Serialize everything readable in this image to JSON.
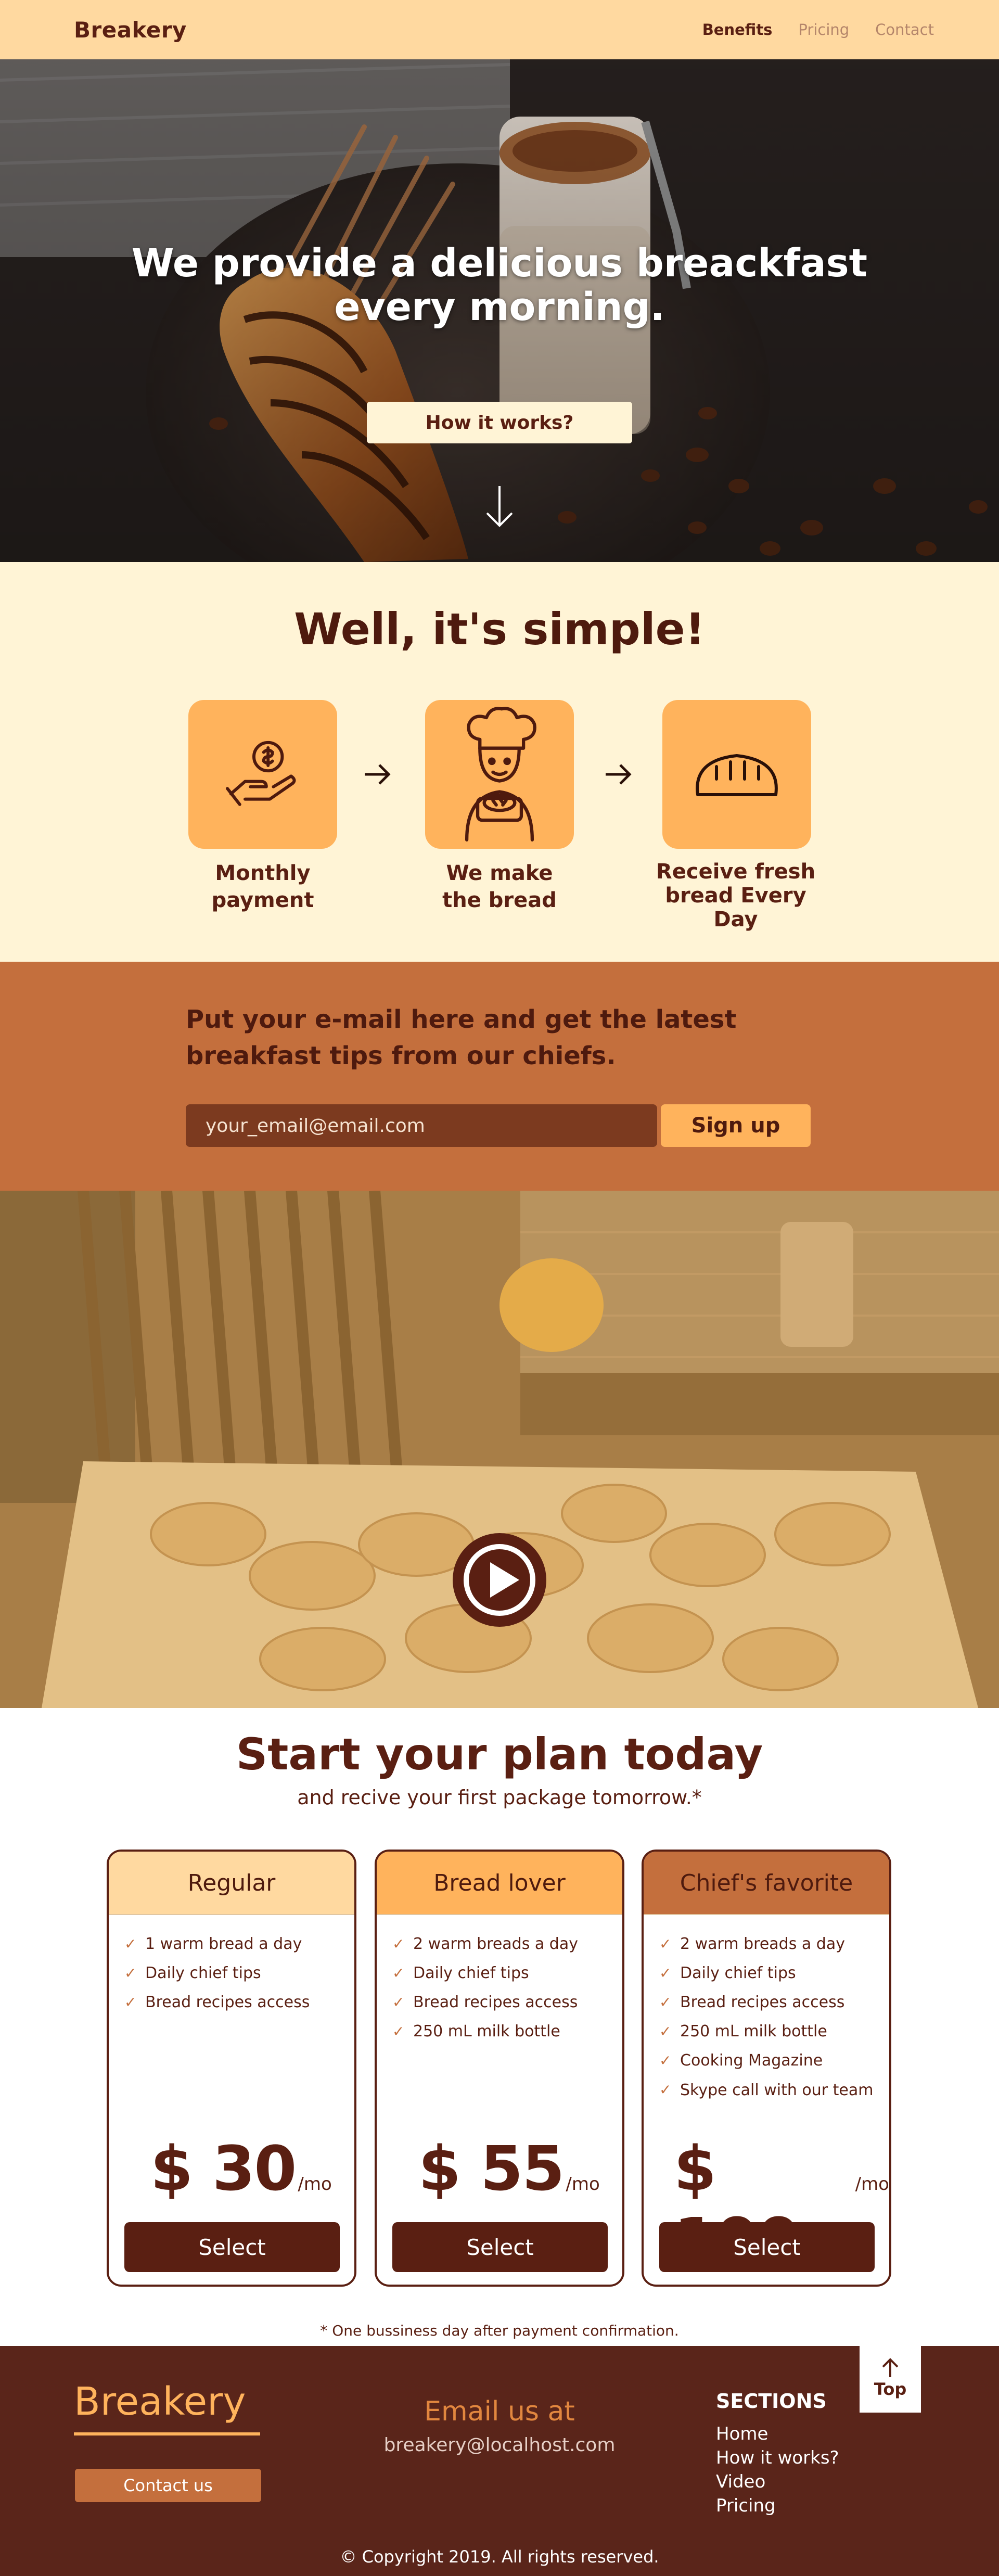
{
  "nav": {
    "brand": "Breakery",
    "links": [
      "Benefits",
      "Pricing",
      "Contact"
    ]
  },
  "hero": {
    "title_line1": "We provide a delicious breackfast",
    "title_line2": "every morning.",
    "button": "How it works?"
  },
  "simple": {
    "title": "Well, it's simple!",
    "steps": [
      {
        "line1": "Monthly",
        "line2": "payment",
        "icon": "hand-coin-icon"
      },
      {
        "line1": "We make",
        "line2": "the bread",
        "icon": "chef-icon"
      },
      {
        "line1": "Receive fresh",
        "line2": "bread Every Day",
        "icon": "bread-icon"
      }
    ]
  },
  "newsletter": {
    "title_line1": "Put your e-mail here and get the latest",
    "title_line2": "breakfast tips from our chiefs.",
    "placeholder": "your_email@email.com",
    "button": "Sign up"
  },
  "video": {
    "play_icon": "play-icon"
  },
  "pricing": {
    "title": "Start your plan today",
    "subtitle": "and recive your first package tomorrow.*",
    "plans": [
      {
        "name": "Regular",
        "color": "#ffd9a0",
        "features": [
          "1 warm bread a day",
          "Daily chief tips",
          "Bread recipes access"
        ],
        "price": "$ 30",
        "per": "/mo",
        "button": "Select"
      },
      {
        "name": "Bread lover",
        "color": "#ffb35c",
        "features": [
          "2 warm breads a day",
          "Daily chief tips",
          "Bread recipes access",
          "250 mL milk bottle"
        ],
        "price": "$ 55",
        "per": "/mo",
        "button": "Select"
      },
      {
        "name": "Chief's favorite",
        "color": "#c46f3d",
        "features": [
          "2 warm breads a day",
          "Daily chief tips",
          "Bread recipes access",
          "250 mL milk bottle",
          "Cooking Magazine",
          "Skype call with our team"
        ],
        "price": "$ 100",
        "per": "/mo",
        "button": "Select"
      }
    ],
    "note": "* One bussiness day after payment confirmation."
  },
  "footer": {
    "brand": "Breakery",
    "contact_button": "Contact us",
    "email_title": "Email us at",
    "email": "breakery@localhost.com",
    "sections_title": "SECTIONS",
    "sections": [
      "Home",
      "How it works?",
      "Video",
      "Pricing"
    ],
    "top_label": "Top",
    "copyright": "© Copyright 2019. All rights reserved."
  },
  "colors": {
    "brown": "#5a1f12",
    "peach": "#ffd9a0",
    "orange": "#ffb35c",
    "rust": "#c46f3d",
    "cream": "#fff4d6"
  }
}
